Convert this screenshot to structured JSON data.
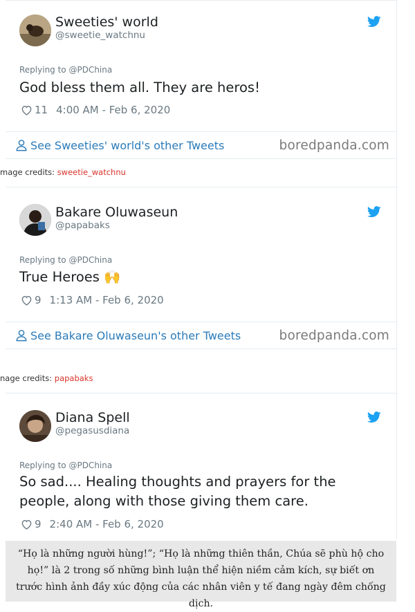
{
  "tweets": [
    {
      "display_name": "Sweeties' world",
      "handle": "@sweetie_watchnu",
      "reply_to": "Replying to @PDChina",
      "text": "God bless them all.  They are heros!",
      "likes": "11",
      "time": "4:00 AM - Feb 6, 2020",
      "see_more": "See Sweeties' world's other Tweets",
      "brand": "boredpanda.com",
      "credits_prefix": "mage credits: ",
      "credits_name": "sweetie_watchnu"
    },
    {
      "display_name": "Bakare Oluwaseun",
      "handle": "@papabaks",
      "reply_to": "Replying to @PDChina",
      "text": "True Heroes 🙌",
      "likes": "9",
      "time": "1:13 AM - Feb 6, 2020",
      "see_more": "See Bakare Oluwaseun's other Tweets",
      "brand": "boredpanda.com",
      "credits_prefix": "nage credits: ",
      "credits_name": "papabaks"
    },
    {
      "display_name": "Diana Spell",
      "handle": "@pegasusdiana",
      "reply_to": "Replying to @PDChina",
      "text": "So sad.... Healing thoughts and prayers for the people, along with those giving them care.",
      "likes": "9",
      "time": "2:40 AM - Feb 6, 2020"
    }
  ],
  "caption": "“Họ là những người hùng!”; “Họ là những thiên thần, Chúa sẽ phù hộ cho họ!” là 2 trong số những bình luận thể hiện niềm cảm kích, sự biết ơn trước hình ảnh đầy xúc động của các nhân viên y tế đang ngày đêm chống dịch.",
  "colors": {
    "twitter_blue": "#1da1f2",
    "link_blue": "#2b7bb9",
    "muted_text": "#697882",
    "credit_red": "#d9342b",
    "caption_bg": "#e8e8e8"
  },
  "icons": [
    "twitter-bird-icon",
    "heart-icon",
    "user-icon",
    "avatar"
  ]
}
